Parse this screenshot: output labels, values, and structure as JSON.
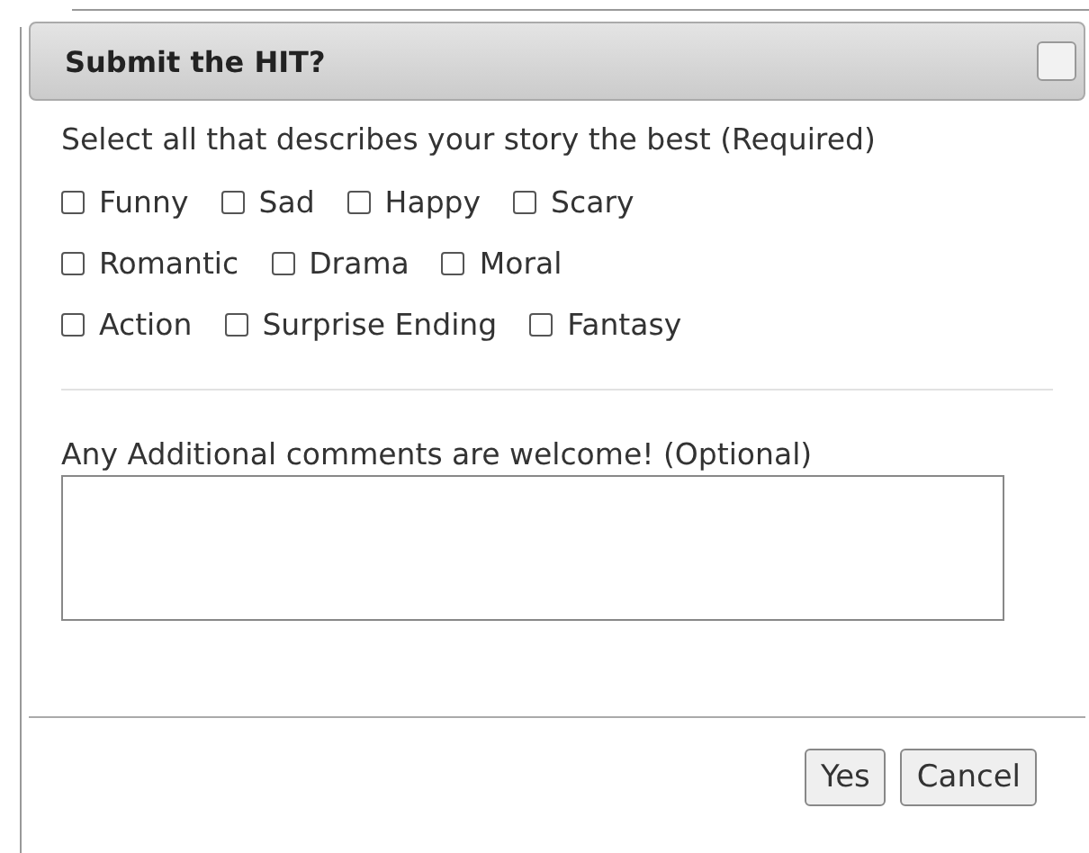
{
  "dialog": {
    "title": "Submit the HIT?",
    "close_button": {
      "checked": false
    }
  },
  "question": "Select all that describes your story the best (Required)",
  "option_rows": [
    [
      {
        "label": "Funny",
        "checked": false
      },
      {
        "label": "Sad",
        "checked": false
      },
      {
        "label": "Happy",
        "checked": false
      },
      {
        "label": "Scary",
        "checked": false
      }
    ],
    [
      {
        "label": "Romantic",
        "checked": false
      },
      {
        "label": "Drama",
        "checked": false
      },
      {
        "label": "Moral",
        "checked": false
      }
    ],
    [
      {
        "label": "Action",
        "checked": false
      },
      {
        "label": "Surprise Ending",
        "checked": false
      },
      {
        "label": "Fantasy",
        "checked": false
      }
    ]
  ],
  "comments_label": "Any Additional comments are welcome! (Optional)",
  "buttons": [
    "Yes",
    "Cancel"
  ]
}
